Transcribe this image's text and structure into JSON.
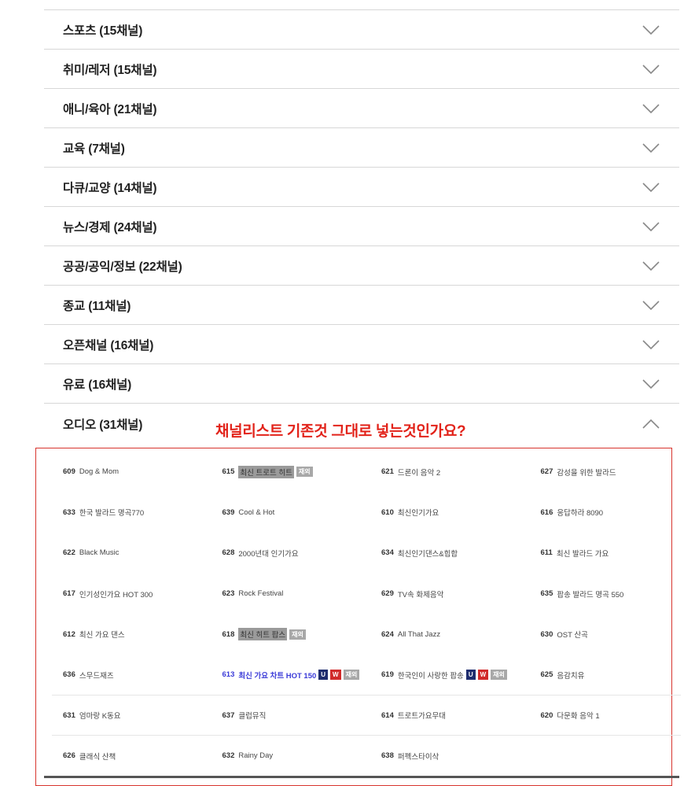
{
  "accordion": {
    "items": [
      {
        "label": "스포츠 (15채널)"
      },
      {
        "label": "취미/레저 (15채널)"
      },
      {
        "label": "애니/육아 (21채널)"
      },
      {
        "label": "교육 (7채널)"
      },
      {
        "label": "다큐/교양 (14채널)"
      },
      {
        "label": "뉴스/경제 (24채널)"
      },
      {
        "label": "공공/공익/정보 (22채널)"
      },
      {
        "label": "종교 (11채널)"
      },
      {
        "label": "오픈채널 (16채널)"
      },
      {
        "label": "유료 (16채널)"
      },
      {
        "label": "오디오 (31채널)",
        "expanded": true
      }
    ]
  },
  "annotation": {
    "text": "채널리스트 기존것 그대로 넣는것인가요?",
    "color": "#e2231a"
  },
  "channels": {
    "rows": [
      [
        {
          "num": "609",
          "name": "Dog & Mom"
        },
        {
          "num": "615",
          "name": "최신 트로트 히트",
          "badge": "재외",
          "highlight": true
        },
        {
          "num": "621",
          "name": "드론이 음악 2"
        },
        {
          "num": "627",
          "name": "감성을 위한 발라드"
        }
      ],
      [
        {
          "num": "633",
          "name": "한국 발라드 명곡770"
        },
        {
          "num": "639",
          "name": "Cool & Hot"
        },
        {
          "num": "610",
          "name": "최신인기가요"
        },
        {
          "num": "616",
          "name": "응답하라 8090"
        }
      ],
      [
        {
          "num": "622",
          "name": "Black Music"
        },
        {
          "num": "628",
          "name": "2000년대 인기가요"
        },
        {
          "num": "634",
          "name": "최신인기댄스&힙합"
        },
        {
          "num": "611",
          "name": "최신 발라드 가요"
        }
      ],
      [
        {
          "num": "617",
          "name": "인기성인가요 HOT 300"
        },
        {
          "num": "623",
          "name": "Rock Festival"
        },
        {
          "num": "629",
          "name": "TV속 화제음악"
        },
        {
          "num": "635",
          "name": "팝송 발라드 명곡 550"
        }
      ],
      [
        {
          "num": "612",
          "name": "최신 가요 댄스"
        },
        {
          "num": "618",
          "name": "최신 히트 팝스",
          "badge": "재외",
          "highlight": true
        },
        {
          "num": "624",
          "name": "All That Jazz"
        },
        {
          "num": "630",
          "name": "OST 산곡"
        }
      ],
      [
        {
          "num": "636",
          "name": "스무드재즈"
        },
        {
          "num": "613",
          "name": "최신 가요 차트 HOT 150",
          "badges": [
            "U",
            "W",
            "재외"
          ],
          "link": true
        },
        {
          "num": "619",
          "name": "한국인이 사랑한 팝송",
          "badges": [
            "U",
            "W",
            "재외"
          ]
        },
        {
          "num": "625",
          "name": "음감치유"
        }
      ],
      [
        {
          "num": "631",
          "name": "엄마랑 K동요"
        },
        {
          "num": "637",
          "name": "클럽뮤직"
        },
        {
          "num": "614",
          "name": "트로트가요무대"
        },
        {
          "num": "620",
          "name": "다문화 음악 1"
        }
      ],
      [
        {
          "num": "626",
          "name": "클래식 산책"
        },
        {
          "num": "632",
          "name": "Rainy Day"
        },
        {
          "num": "638",
          "name": "퍼펙스타이삭"
        },
        {
          "num": "",
          "name": ""
        }
      ]
    ]
  },
  "colors": {
    "accent_red": "#e2231a",
    "badge_u": "#1f2d6e",
    "badge_w": "#d12a2a",
    "link_blue": "#3b3bd8"
  }
}
